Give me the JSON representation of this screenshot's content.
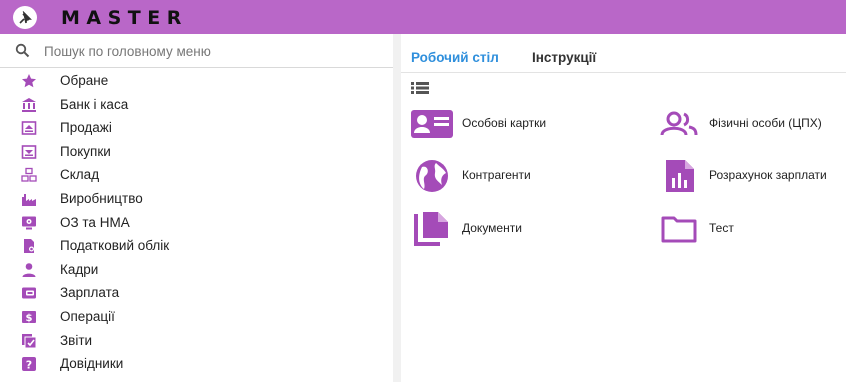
{
  "app": {
    "title": "MASTER",
    "accent_color": "#b967c8",
    "icon": "pin-icon"
  },
  "search": {
    "placeholder": "Пошук по головному меню",
    "value": "",
    "icon": "search-icon"
  },
  "sidebar": {
    "items": [
      {
        "label": "Обране",
        "icon": "star-icon"
      },
      {
        "label": "Банк і каса",
        "icon": "bank-icon"
      },
      {
        "label": "Продажі",
        "icon": "sales-icon"
      },
      {
        "label": "Покупки",
        "icon": "purchases-icon"
      },
      {
        "label": "Склад",
        "icon": "warehouse-icon"
      },
      {
        "label": "Виробництво",
        "icon": "factory-icon"
      },
      {
        "label": "ОЗ та НМА",
        "icon": "monitor-icon"
      },
      {
        "label": "Податковий облік",
        "icon": "tax-document-icon"
      },
      {
        "label": "Кадри",
        "icon": "person-icon"
      },
      {
        "label": "Зарплата",
        "icon": "wallet-icon"
      },
      {
        "label": "Операції",
        "icon": "dollar-icon"
      },
      {
        "label": "Звіти",
        "icon": "reports-icon"
      },
      {
        "label": "Довідники",
        "icon": "help-icon"
      }
    ]
  },
  "main": {
    "tabs": [
      {
        "label": "Робочий стіл",
        "active": true
      },
      {
        "label": "Інструкції",
        "active": false
      }
    ],
    "view_toggle_icon": "list-view-icon",
    "tiles": [
      {
        "label": "Особові картки",
        "icon": "id-card-icon"
      },
      {
        "label": "Фізичні особи (ЦПХ)",
        "icon": "people-icon"
      },
      {
        "label": "Контрагенти",
        "icon": "globe-icon"
      },
      {
        "label": "Розрахунок зарплати",
        "icon": "chart-document-icon"
      },
      {
        "label": "Документи",
        "icon": "documents-icon"
      },
      {
        "label": "Тест",
        "icon": "folder-icon"
      }
    ]
  }
}
